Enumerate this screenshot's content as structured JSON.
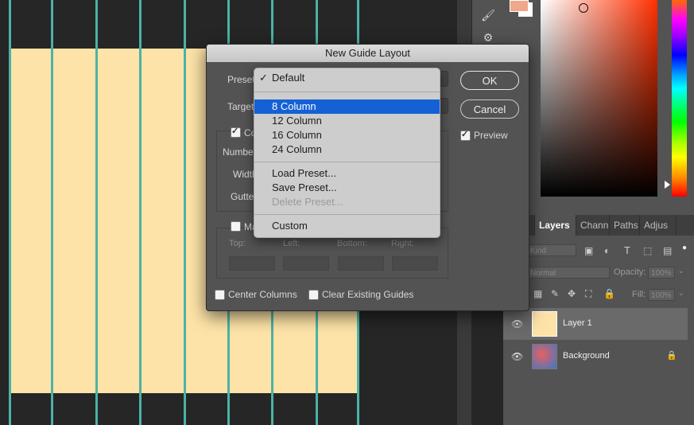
{
  "dialog": {
    "title": "New Guide Layout",
    "preset_label": "Preset",
    "target_label": "Target",
    "columns_label": "Co",
    "number_label": "Number",
    "width_label": "Width",
    "gutter_label": "Gutte",
    "margin_label": "Ma",
    "margin_fields": {
      "top": "Top:",
      "left": "Left:",
      "bottom": "Bottom:",
      "right": "Right:"
    },
    "ok": "OK",
    "cancel": "Cancel",
    "preview": "Preview",
    "center_columns": "Center Columns",
    "clear_guides": "Clear Existing Guides"
  },
  "preset_menu": {
    "items": [
      {
        "label": "Default",
        "checked": true
      },
      {
        "label": "8 Column",
        "selected": true
      },
      {
        "label": "12 Column"
      },
      {
        "label": "16 Column"
      },
      {
        "label": "24 Column"
      },
      {
        "label": "Load Preset..."
      },
      {
        "label": "Save Preset..."
      },
      {
        "label": "Delete Preset...",
        "disabled": true
      },
      {
        "label": "Custom"
      }
    ]
  },
  "layers_panel": {
    "tabs": [
      "lor",
      "Layers",
      "Chann",
      "Paths",
      "Adjus"
    ],
    "kind_label": "Kind",
    "blend_mode": "Normal",
    "opacity_label": "Opacity:",
    "opacity_value": "100%",
    "fill_label": "Fill:",
    "fill_value": "100%",
    "layers": [
      {
        "name": "Layer 1",
        "thumb_color": "#fde3a7"
      },
      {
        "name": "Background"
      }
    ]
  },
  "colors": {
    "canvas_fill": "#fde3a7",
    "guide": "#4cb2a6",
    "foreground_swatch": "#f0a78a",
    "menu_highlight": "#1461d6"
  }
}
